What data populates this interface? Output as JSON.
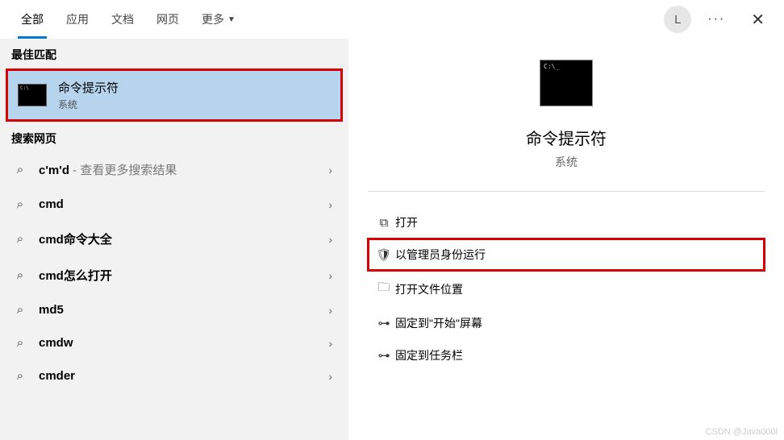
{
  "header": {
    "tabs": {
      "all": "全部",
      "apps": "应用",
      "docs": "文档",
      "web": "网页",
      "more": "更多"
    },
    "avatar_initial": "L"
  },
  "left": {
    "best_match_label": "最佳匹配",
    "best_match": {
      "title": "命令提示符",
      "subtitle": "系统"
    },
    "web_label": "搜索网页",
    "web_items": [
      {
        "text": "c'm'd",
        "hint": " - 查看更多搜索结果"
      },
      {
        "text": "cmd",
        "hint": ""
      },
      {
        "text": "cmd命令大全",
        "hint": ""
      },
      {
        "text": "cmd怎么打开",
        "hint": ""
      },
      {
        "text": "md5",
        "hint": ""
      },
      {
        "text": "cmdw",
        "hint": ""
      },
      {
        "text": "cmder",
        "hint": ""
      }
    ]
  },
  "right": {
    "title": "命令提示符",
    "subtitle": "系统",
    "actions": {
      "open": "打开",
      "run_admin": "以管理员身份运行",
      "open_location": "打开文件位置",
      "pin_start": "固定到\"开始\"屏幕",
      "pin_taskbar": "固定到任务栏"
    }
  },
  "watermark": "CSDN @Java000l"
}
